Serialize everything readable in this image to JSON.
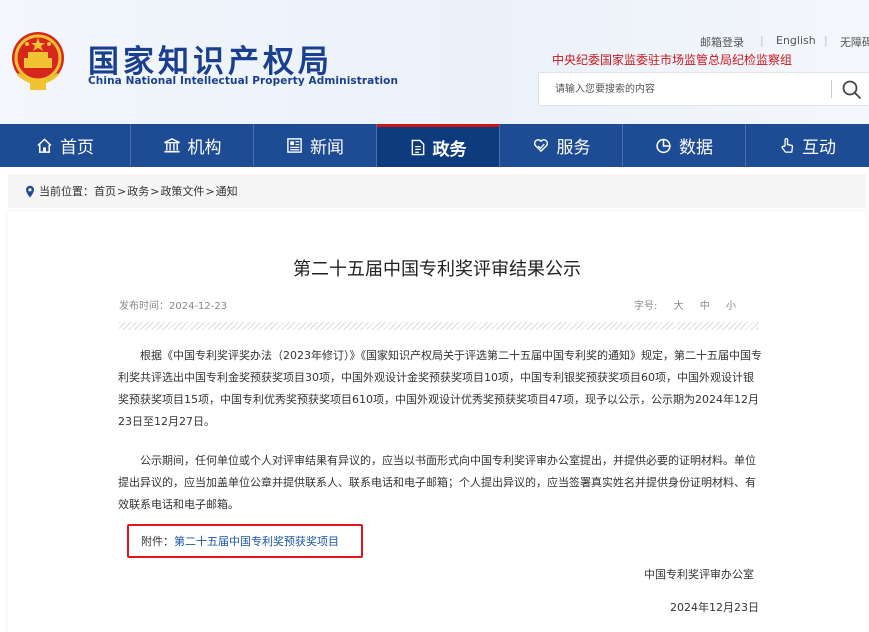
{
  "header": {
    "title_cn": "国家知识产权局",
    "title_en": "China National Intellectual Property Administration",
    "links": [
      "邮箱登录",
      "English",
      "无障碍"
    ],
    "discipline_text": "中央纪委国家监委驻市场监管总局纪检监察组",
    "search": {
      "placeholder": "请输入您要搜索的内容"
    },
    "icons": {
      "emblem": "national-emblem-icon",
      "search": "search-icon"
    }
  },
  "nav": {
    "items": [
      {
        "label": "首页",
        "icon": "home-icon",
        "active": false
      },
      {
        "label": "机构",
        "icon": "building-icon",
        "active": false
      },
      {
        "label": "新闻",
        "icon": "newspaper-icon",
        "active": false
      },
      {
        "label": "政务",
        "icon": "document-icon",
        "active": true
      },
      {
        "label": "服务",
        "icon": "heart-hand-icon",
        "active": false
      },
      {
        "label": "数据",
        "icon": "pie-chart-icon",
        "active": false
      },
      {
        "label": "互动",
        "icon": "hand-pointer-icon",
        "active": false
      }
    ]
  },
  "breadcrumb": {
    "prefix": "当前位置：",
    "items": [
      "首页",
      "政务",
      "政策文件",
      "通知"
    ],
    "separator": ">"
  },
  "article": {
    "title": "第二十五届中国专利奖评审结果公示",
    "publish_label": "发布时间：",
    "publish_date": "2024-12-23",
    "font_size_label": "字号:",
    "font_sizes": [
      "大",
      "中",
      "小"
    ],
    "paragraph1": "根据《中国专利奖评奖办法（2023年修订）》《国家知识产权局关于评选第二十五届中国专利奖的通知》规定，第二十五届中国专利奖共评选出中国专利金奖预获奖项目30项，中国外观设计金奖预获奖项目10项，中国专利银奖预获奖项目60项，中国外观设计银奖预获奖项目15项，中国专利优秀奖预获奖项目610项，中国外观设计优秀奖预获奖项目47项，现予以公示，公示期为2024年12月23日至12月27日。",
    "paragraph2": "公示期间，任何单位或个人对评审结果有异议的，应当以书面形式向中国专利奖评审办公室提出，并提供必要的证明材料。单位提出异议的，应当加盖单位公章并提供联系人、联系电话和电子邮箱；个人提出异议的，应当签署真实姓名并提供身份证明材料、有效联系电话和电子邮箱。",
    "attachment_label": "附件：",
    "attachment_link": "第二十五届中国专利奖预获奖项目",
    "signature": "中国专利奖评审办公室",
    "sign_date": "2024年12月23日"
  },
  "colors": {
    "brand_blue": "#1d4b94",
    "active_nav": "#0e3a7e",
    "accent_red": "#c8161d",
    "highlight_box": "#e0151b",
    "link_blue": "#1a55a6"
  }
}
